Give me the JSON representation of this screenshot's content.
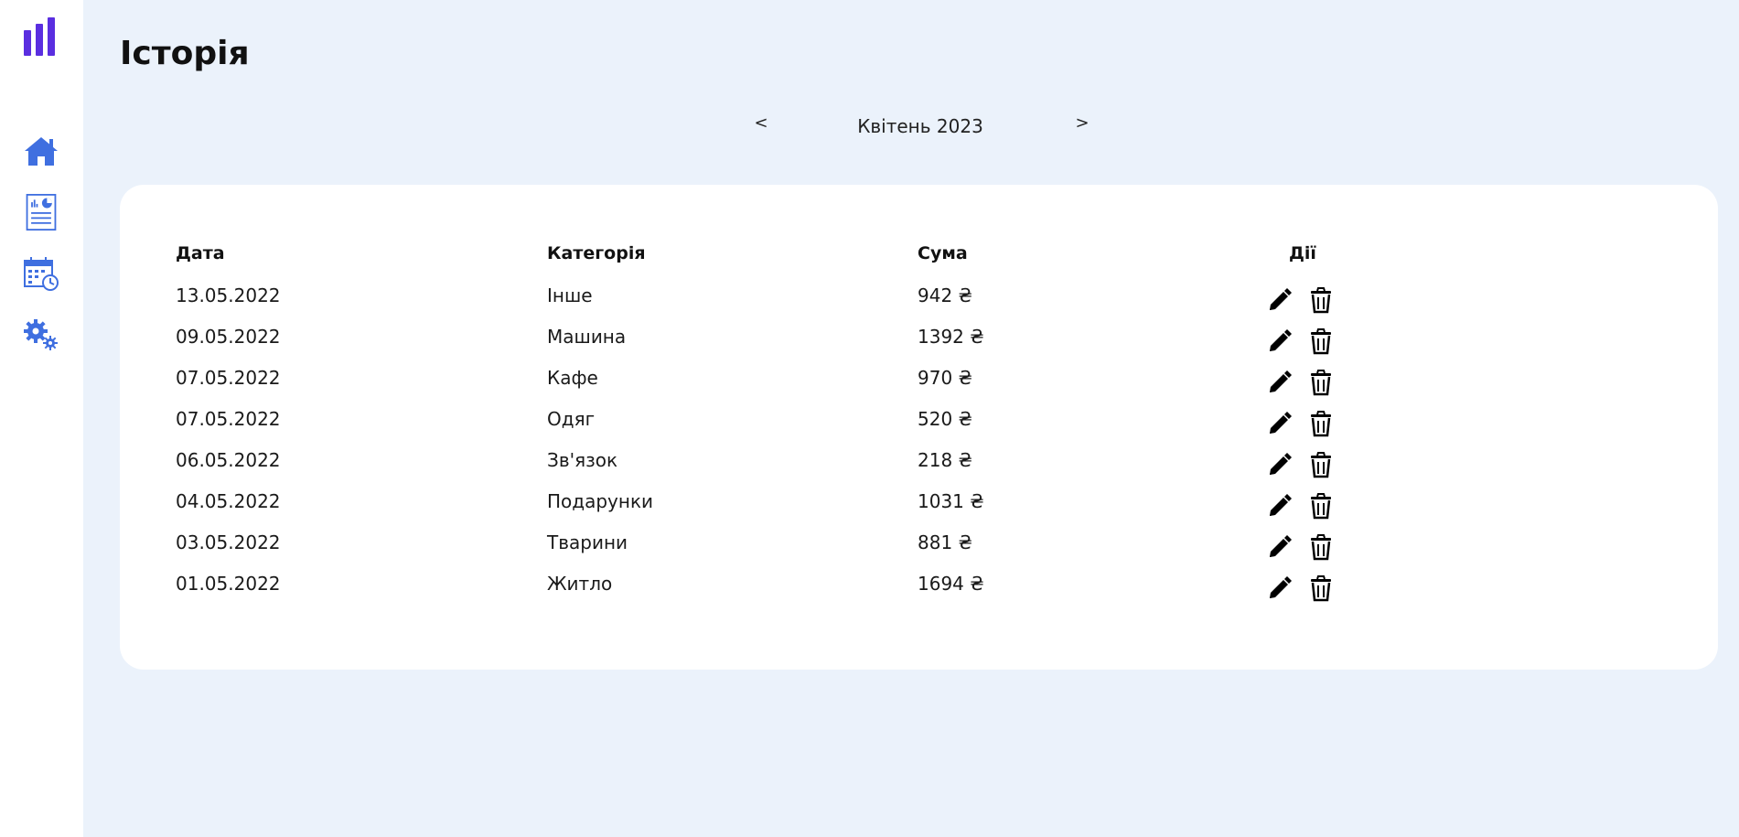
{
  "sidebar": {
    "logo_icon": "bar-chart-logo",
    "accent_color": "#5a2ee0",
    "icon_color": "#3f6fe0",
    "items": [
      {
        "name": "home",
        "icon": "home-icon"
      },
      {
        "name": "reports",
        "icon": "report-chart-icon"
      },
      {
        "name": "calendar",
        "icon": "calendar-clock-icon"
      },
      {
        "name": "settings",
        "icon": "gears-icon"
      }
    ]
  },
  "header": {
    "title": "Історія"
  },
  "month_nav": {
    "prev": "<",
    "label": "Квітень 2023",
    "next": ">"
  },
  "table": {
    "columns": [
      "Дата",
      "Категорія",
      "Сума",
      "Дії"
    ],
    "rows": [
      {
        "date": "13.05.2022",
        "category": "Інше",
        "amount": "942 ₴"
      },
      {
        "date": "09.05.2022",
        "category": "Машина",
        "amount": "1392 ₴"
      },
      {
        "date": "07.05.2022",
        "category": "Кафе",
        "amount": "970 ₴"
      },
      {
        "date": "07.05.2022",
        "category": "Одяг",
        "amount": "520 ₴"
      },
      {
        "date": "06.05.2022",
        "category": "Зв'язок",
        "amount": "218 ₴"
      },
      {
        "date": "04.05.2022",
        "category": "Подарунки",
        "amount": "1031 ₴"
      },
      {
        "date": "03.05.2022",
        "category": "Тварини",
        "amount": "881 ₴"
      },
      {
        "date": "01.05.2022",
        "category": "Житло",
        "amount": "1694 ₴"
      }
    ],
    "row_actions": [
      "pencil-icon",
      "trash-icon"
    ]
  }
}
